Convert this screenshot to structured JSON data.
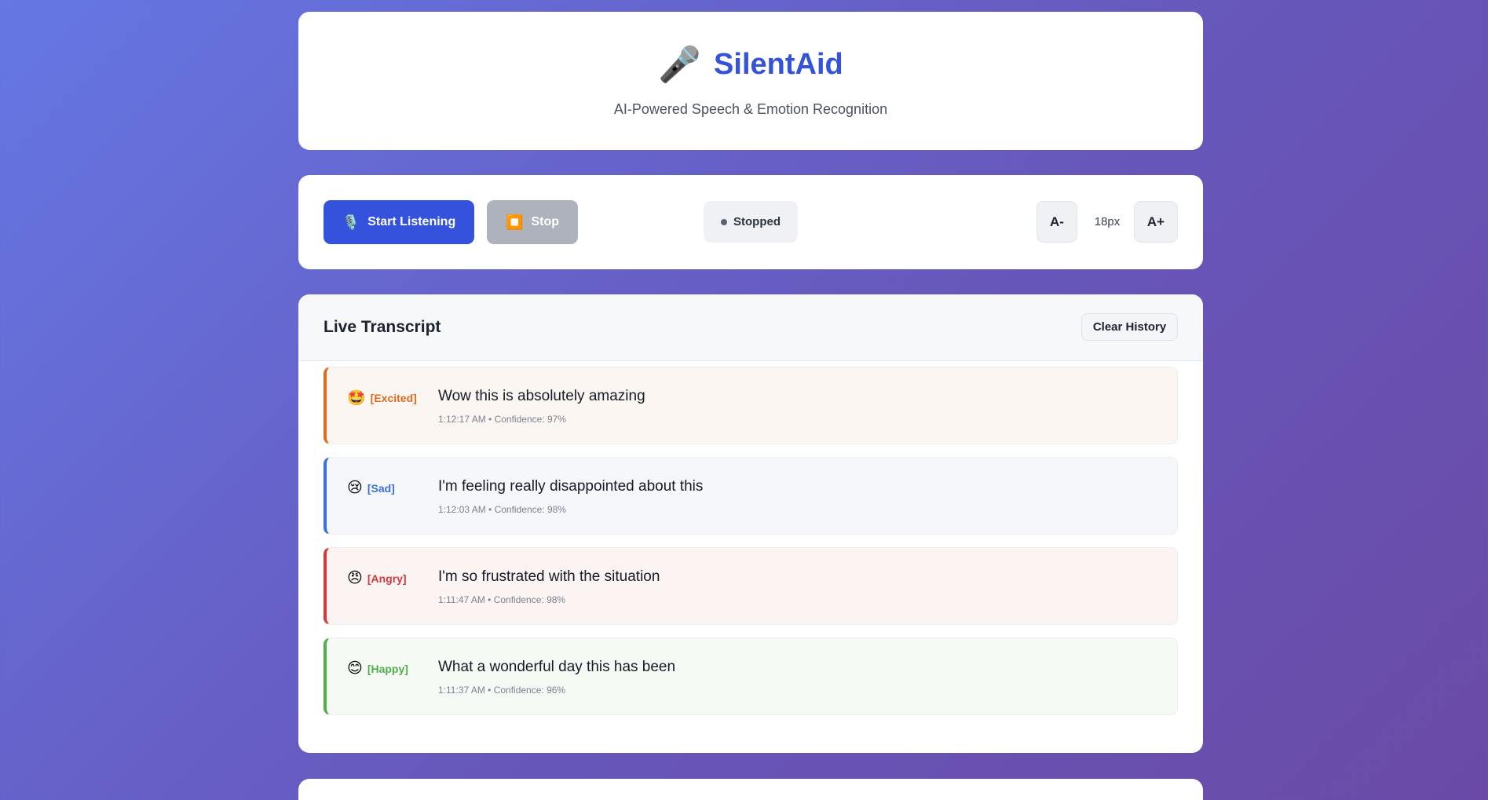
{
  "header": {
    "icon": "microphone-icon",
    "app_name": "SilentAid",
    "subtitle": "AI-Powered Speech & Emotion Recognition"
  },
  "controls": {
    "start_label": "Start Listening",
    "start_icon": "microphone-icon",
    "stop_label": "Stop",
    "stop_icon": "stop-icon",
    "status": "Stopped",
    "font_decrease": "A-",
    "font_size": "18px",
    "font_increase": "A+"
  },
  "transcript": {
    "title": "Live Transcript",
    "clear_label": "Clear History",
    "entries": [
      {
        "emoji": "🤩",
        "emotion": "[Excited]",
        "text": "Wow this is absolutely amazing",
        "meta": "1:12:17 AM • Confidence: 97%",
        "color": "#dd6b20",
        "bg": "#fcf6f2"
      },
      {
        "emoji": "😢",
        "emotion": "[Sad]",
        "text": "I'm feeling really disappointed about this",
        "meta": "1:12:03 AM • Confidence: 98%",
        "color": "#3b6fe0",
        "bg": "#f5f7fb"
      },
      {
        "emoji": "😠",
        "emotion": "[Angry]",
        "text": "I'm so frustrated with the situation",
        "meta": "1:11:47 AM • Confidence: 98%",
        "color": "#d33a3a",
        "bg": "#fcf3f3"
      },
      {
        "emoji": "😊",
        "emotion": "[Happy]",
        "text": "What a wonderful day this has been",
        "meta": "1:11:37 AM • Confidence: 96%",
        "color": "#4fae4a",
        "bg": "#f5faf4"
      }
    ]
  }
}
